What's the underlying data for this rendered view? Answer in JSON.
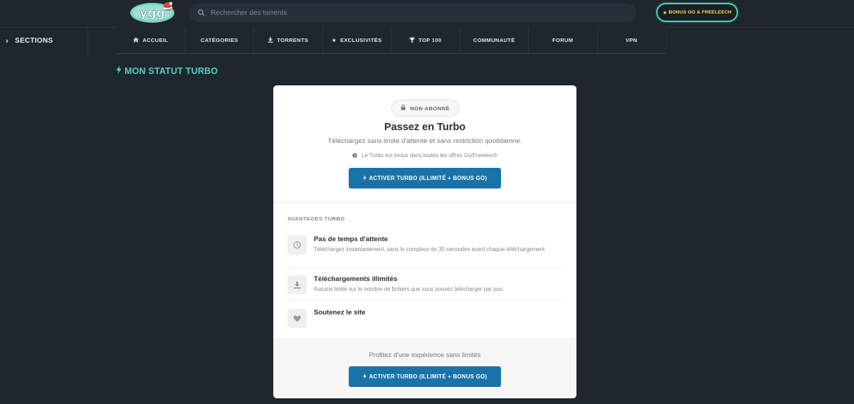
{
  "header": {
    "logo_text": "ygg",
    "search_placeholder": "Rechercher des torrents",
    "bonus_label": "BONUS GO & FREELEECH"
  },
  "sections": {
    "label": "SECTIONS"
  },
  "nav": {
    "items": [
      {
        "label": "ACCUEIL",
        "icon": "home-icon"
      },
      {
        "label": "CATÉGORIES",
        "icon": ""
      },
      {
        "label": "TORRENTS",
        "icon": "download-icon"
      },
      {
        "label": "EXCLUSIVITÉS",
        "icon": "star-icon"
      },
      {
        "label": "TOP 100",
        "icon": "trophy-icon"
      },
      {
        "label": "COMMUNAUTÉ",
        "icon": ""
      },
      {
        "label": "FORUM",
        "icon": ""
      },
      {
        "label": "VPN",
        "icon": ""
      }
    ]
  },
  "page": {
    "title": "MON STATUT TURBO"
  },
  "card": {
    "status_badge": "NON ABONNÉ",
    "heading": "Passez en Turbo",
    "subtitle": "Téléchargez sans limite d'attente et sans restriction quotidienne.",
    "info": "Le Turbo est inclus dans toutes les offres Go/Freeleech",
    "cta_label": "ACTIVER TURBO (ILLIMITÉ + BONUS GO)",
    "advantages_title": "AVANTAGES TURBO",
    "advantages": [
      {
        "title": "Pas de temps d'attente",
        "desc": "Téléchargez instantanément, sans le compteur de 30 secondes avant chaque téléchargement.",
        "icon": "clock-icon"
      },
      {
        "title": "Téléchargements illimités",
        "desc": "Aucune limite sur le nombre de fichiers que vous pouvez télécharger par jour.",
        "icon": "download-icon"
      },
      {
        "title": "Soutenez le site",
        "desc": "",
        "icon": "heart-icon"
      }
    ],
    "bottom_text": "Profitez d'une expérience sans limites",
    "bottom_cta_label": "ACTIVER TURBO (ILLIMITÉ + BONUS GO)"
  },
  "colors": {
    "background": "#1f262d",
    "accent_teal": "#4fd1c5",
    "cta_blue": "#1a73a8",
    "bonus_yellow": "#f3e24a"
  }
}
